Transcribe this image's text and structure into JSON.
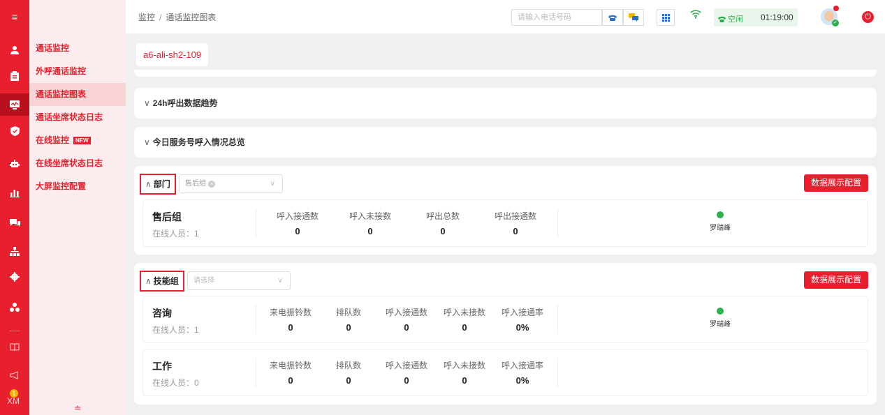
{
  "rail": {
    "menu_icon": "≡",
    "items": [
      {
        "icon": "user-icon",
        "glyph": "👤"
      },
      {
        "icon": "clipboard-icon",
        "glyph": "📋"
      },
      {
        "icon": "monitor-icon",
        "glyph": "🖥"
      },
      {
        "icon": "shield-icon",
        "glyph": "🛡"
      },
      {
        "icon": "robot-icon",
        "glyph": "🤖"
      },
      {
        "icon": "bar-chart-icon",
        "glyph": "📊"
      },
      {
        "icon": "chat-icon",
        "glyph": "💬"
      },
      {
        "icon": "org-chart-icon",
        "glyph": "⛁"
      },
      {
        "icon": "gear-icon",
        "glyph": "⚙"
      },
      {
        "icon": "cluster-icon",
        "glyph": "⁂"
      },
      {
        "icon": "book-icon",
        "glyph": "📖"
      },
      {
        "icon": "megaphone-icon",
        "glyph": "📣"
      }
    ],
    "badge_count": "1",
    "bottom_label": "XM"
  },
  "submenu": {
    "items": [
      {
        "label": "通话监控"
      },
      {
        "label": "外呼通话监控"
      },
      {
        "label": "通话监控图表"
      },
      {
        "label": "通话坐席状态日志"
      },
      {
        "label": "在线监控",
        "badge": "NEW"
      },
      {
        "label": "在线坐席状态日志"
      },
      {
        "label": "大屏监控配置"
      }
    ],
    "collapse_glyph": "≐"
  },
  "header": {
    "breadcrumb": [
      "监控",
      "通话监控图表"
    ],
    "breadcrumb_sep": "/",
    "phone_placeholder": "请输入电话号码",
    "status": "空闲",
    "time": "01:19:00"
  },
  "tag": "a6-ali-sh2-109",
  "folds": [
    "24h呼出数据趋势",
    "今日服务号呼入情况总览"
  ],
  "department": {
    "title": "部门",
    "selected_chip": "售后组",
    "config_button": "数据展示配置",
    "rows": [
      {
        "name": "售后组",
        "online_label": "在线人员：",
        "online_count": "1",
        "stats": [
          {
            "label": "呼入接通数",
            "value": "0"
          },
          {
            "label": "呼入未接数",
            "value": "0"
          },
          {
            "label": "呼出总数",
            "value": "0"
          },
          {
            "label": "呼出接通数",
            "value": "0"
          }
        ],
        "agent": "罗瑞峰"
      }
    ]
  },
  "skill_group": {
    "title": "技能组",
    "placeholder": "请选择",
    "config_button": "数据展示配置",
    "rows": [
      {
        "name": "咨询",
        "online_label": "在线人员：",
        "online_count": "1",
        "stats": [
          {
            "label": "来电振铃数",
            "value": "0"
          },
          {
            "label": "排队数",
            "value": "0"
          },
          {
            "label": "呼入接通数",
            "value": "0"
          },
          {
            "label": "呼入未接数",
            "value": "0"
          },
          {
            "label": "呼入接通率",
            "value": "0%"
          }
        ],
        "agent": "罗瑞峰"
      },
      {
        "name": "工作",
        "online_label": "在线人员：",
        "online_count": "0",
        "stats": [
          {
            "label": "来电振铃数",
            "value": "0"
          },
          {
            "label": "排队数",
            "value": "0"
          },
          {
            "label": "呼入接通数",
            "value": "0"
          },
          {
            "label": "呼入未接数",
            "value": "0"
          },
          {
            "label": "呼入接通率",
            "value": "0%"
          }
        ],
        "agent": ""
      }
    ]
  },
  "colors": {
    "brand_red": "#e8202e",
    "online_green": "#2bb24c"
  }
}
